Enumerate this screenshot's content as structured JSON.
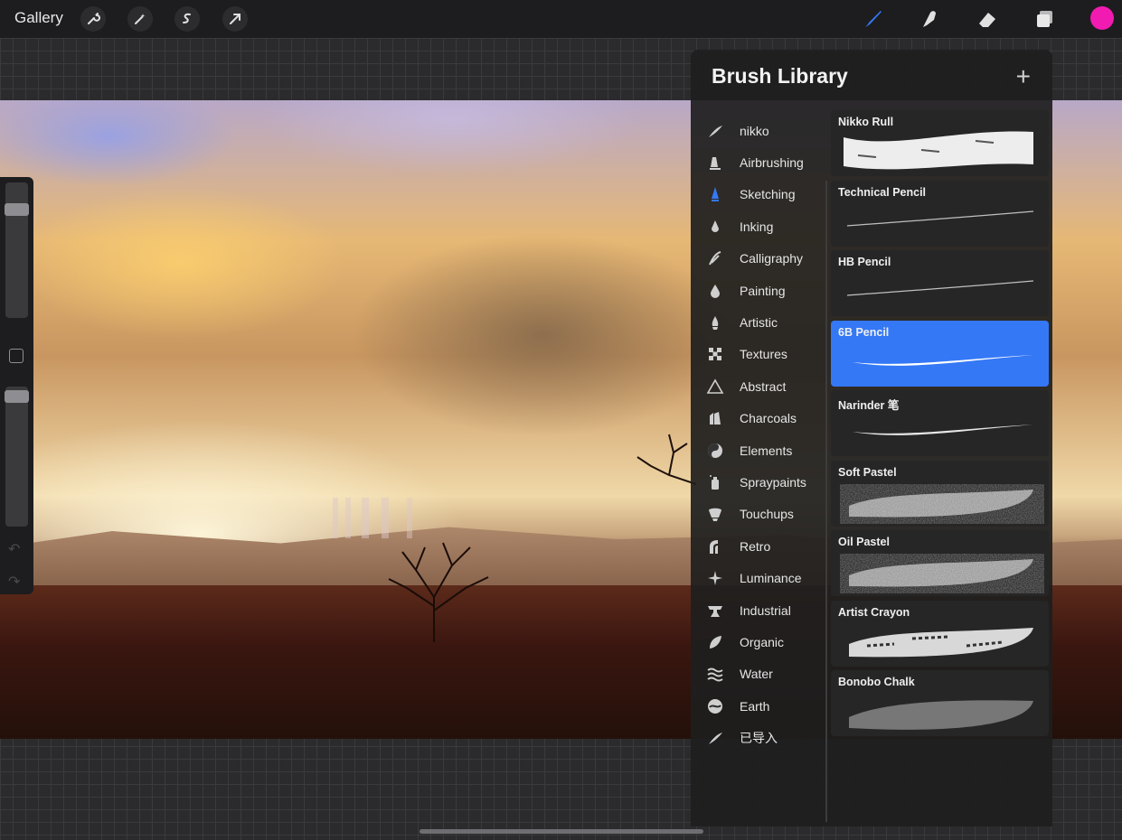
{
  "topbar": {
    "gallery_label": "Gallery",
    "left_tools": [
      "wrench-icon",
      "magic-wand-icon",
      "selection-icon",
      "transform-arrow-icon"
    ],
    "right_tools": [
      "brush-icon",
      "smudge-icon",
      "eraser-icon",
      "layers-icon"
    ],
    "active_tool": "brush-icon",
    "current_color": "#f21bb1",
    "active_tool_color": "#3478f6"
  },
  "brush_library": {
    "title": "Brush Library",
    "add_symbol": "+",
    "categories": [
      {
        "label": "nikko",
        "icon": "leaf-stroke-icon"
      },
      {
        "label": "Airbrushing",
        "icon": "airbrush-icon"
      },
      {
        "label": "Sketching",
        "icon": "pencil-tip-icon",
        "selected": true
      },
      {
        "label": "Inking",
        "icon": "ink-drop-icon"
      },
      {
        "label": "Calligraphy",
        "icon": "calligraphy-icon"
      },
      {
        "label": "Painting",
        "icon": "paint-drop-icon"
      },
      {
        "label": "Artistic",
        "icon": "artistic-icon"
      },
      {
        "label": "Textures",
        "icon": "checker-icon"
      },
      {
        "label": "Abstract",
        "icon": "triangle-icon"
      },
      {
        "label": "Charcoals",
        "icon": "charcoal-icon"
      },
      {
        "label": "Elements",
        "icon": "yin-yang-icon"
      },
      {
        "label": "Spraypaints",
        "icon": "spray-can-icon"
      },
      {
        "label": "Touchups",
        "icon": "touchup-icon"
      },
      {
        "label": "Retro",
        "icon": "retro-icon"
      },
      {
        "label": "Luminance",
        "icon": "sparkle-icon"
      },
      {
        "label": "Industrial",
        "icon": "anvil-icon"
      },
      {
        "label": "Organic",
        "icon": "leaf-icon"
      },
      {
        "label": "Water",
        "icon": "waves-icon"
      },
      {
        "label": "Earth",
        "icon": "earth-swirl-icon"
      },
      {
        "label": "已导入",
        "icon": "imported-stroke-icon"
      }
    ],
    "brushes": [
      {
        "name": "Nikko Rull",
        "style": "rough-wide"
      },
      {
        "name": "Technical Pencil",
        "style": "thin"
      },
      {
        "name": "HB Pencil",
        "style": "thin"
      },
      {
        "name": "6B Pencil",
        "style": "medium",
        "selected": true
      },
      {
        "name": "Narinder 笔",
        "style": "medium"
      },
      {
        "name": "Soft Pastel",
        "style": "pastel"
      },
      {
        "name": "Oil Pastel",
        "style": "pastel"
      },
      {
        "name": "Artist Crayon",
        "style": "crayon"
      },
      {
        "name": "Bonobo Chalk",
        "style": "chalk"
      }
    ]
  }
}
